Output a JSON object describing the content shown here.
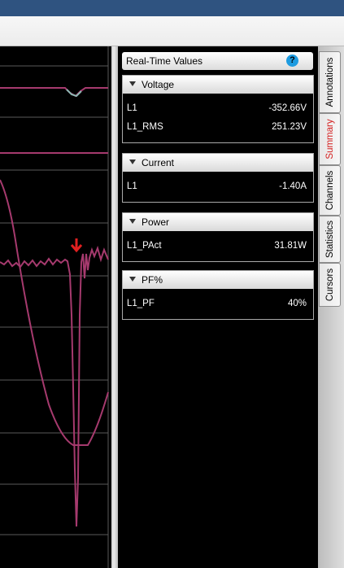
{
  "panel": {
    "title": "Real-Time Values",
    "help_glyph": "?",
    "sections": [
      {
        "title": "Voltage",
        "rows": [
          {
            "name": "L1",
            "value": "-352.66V"
          },
          {
            "name": "L1_RMS",
            "value": "251.23V"
          }
        ]
      },
      {
        "title": "Current",
        "rows": [
          {
            "name": "L1",
            "value": "-1.40A"
          }
        ]
      },
      {
        "title": "Power",
        "rows": [
          {
            "name": "L1_PAct",
            "value": "31.81W"
          }
        ]
      },
      {
        "title": "PF%",
        "rows": [
          {
            "name": "L1_PF",
            "value": "40%"
          }
        ]
      }
    ]
  },
  "side_tabs": [
    "Annotations",
    "Summary",
    "Channels",
    "Statistics",
    "Cursors"
  ],
  "active_tab": "Summary",
  "colors": {
    "waveform": "#a63a6e",
    "waveform_alt": "#8fb8b4",
    "marker": "#e02020",
    "grid": "#5a5a5a",
    "panel_bg": "#000000",
    "active_tab_text": "#d42020"
  },
  "icons": {
    "collapse": "triangle-down-icon",
    "help": "help-icon",
    "marker": "red-arrow-down-icon"
  }
}
